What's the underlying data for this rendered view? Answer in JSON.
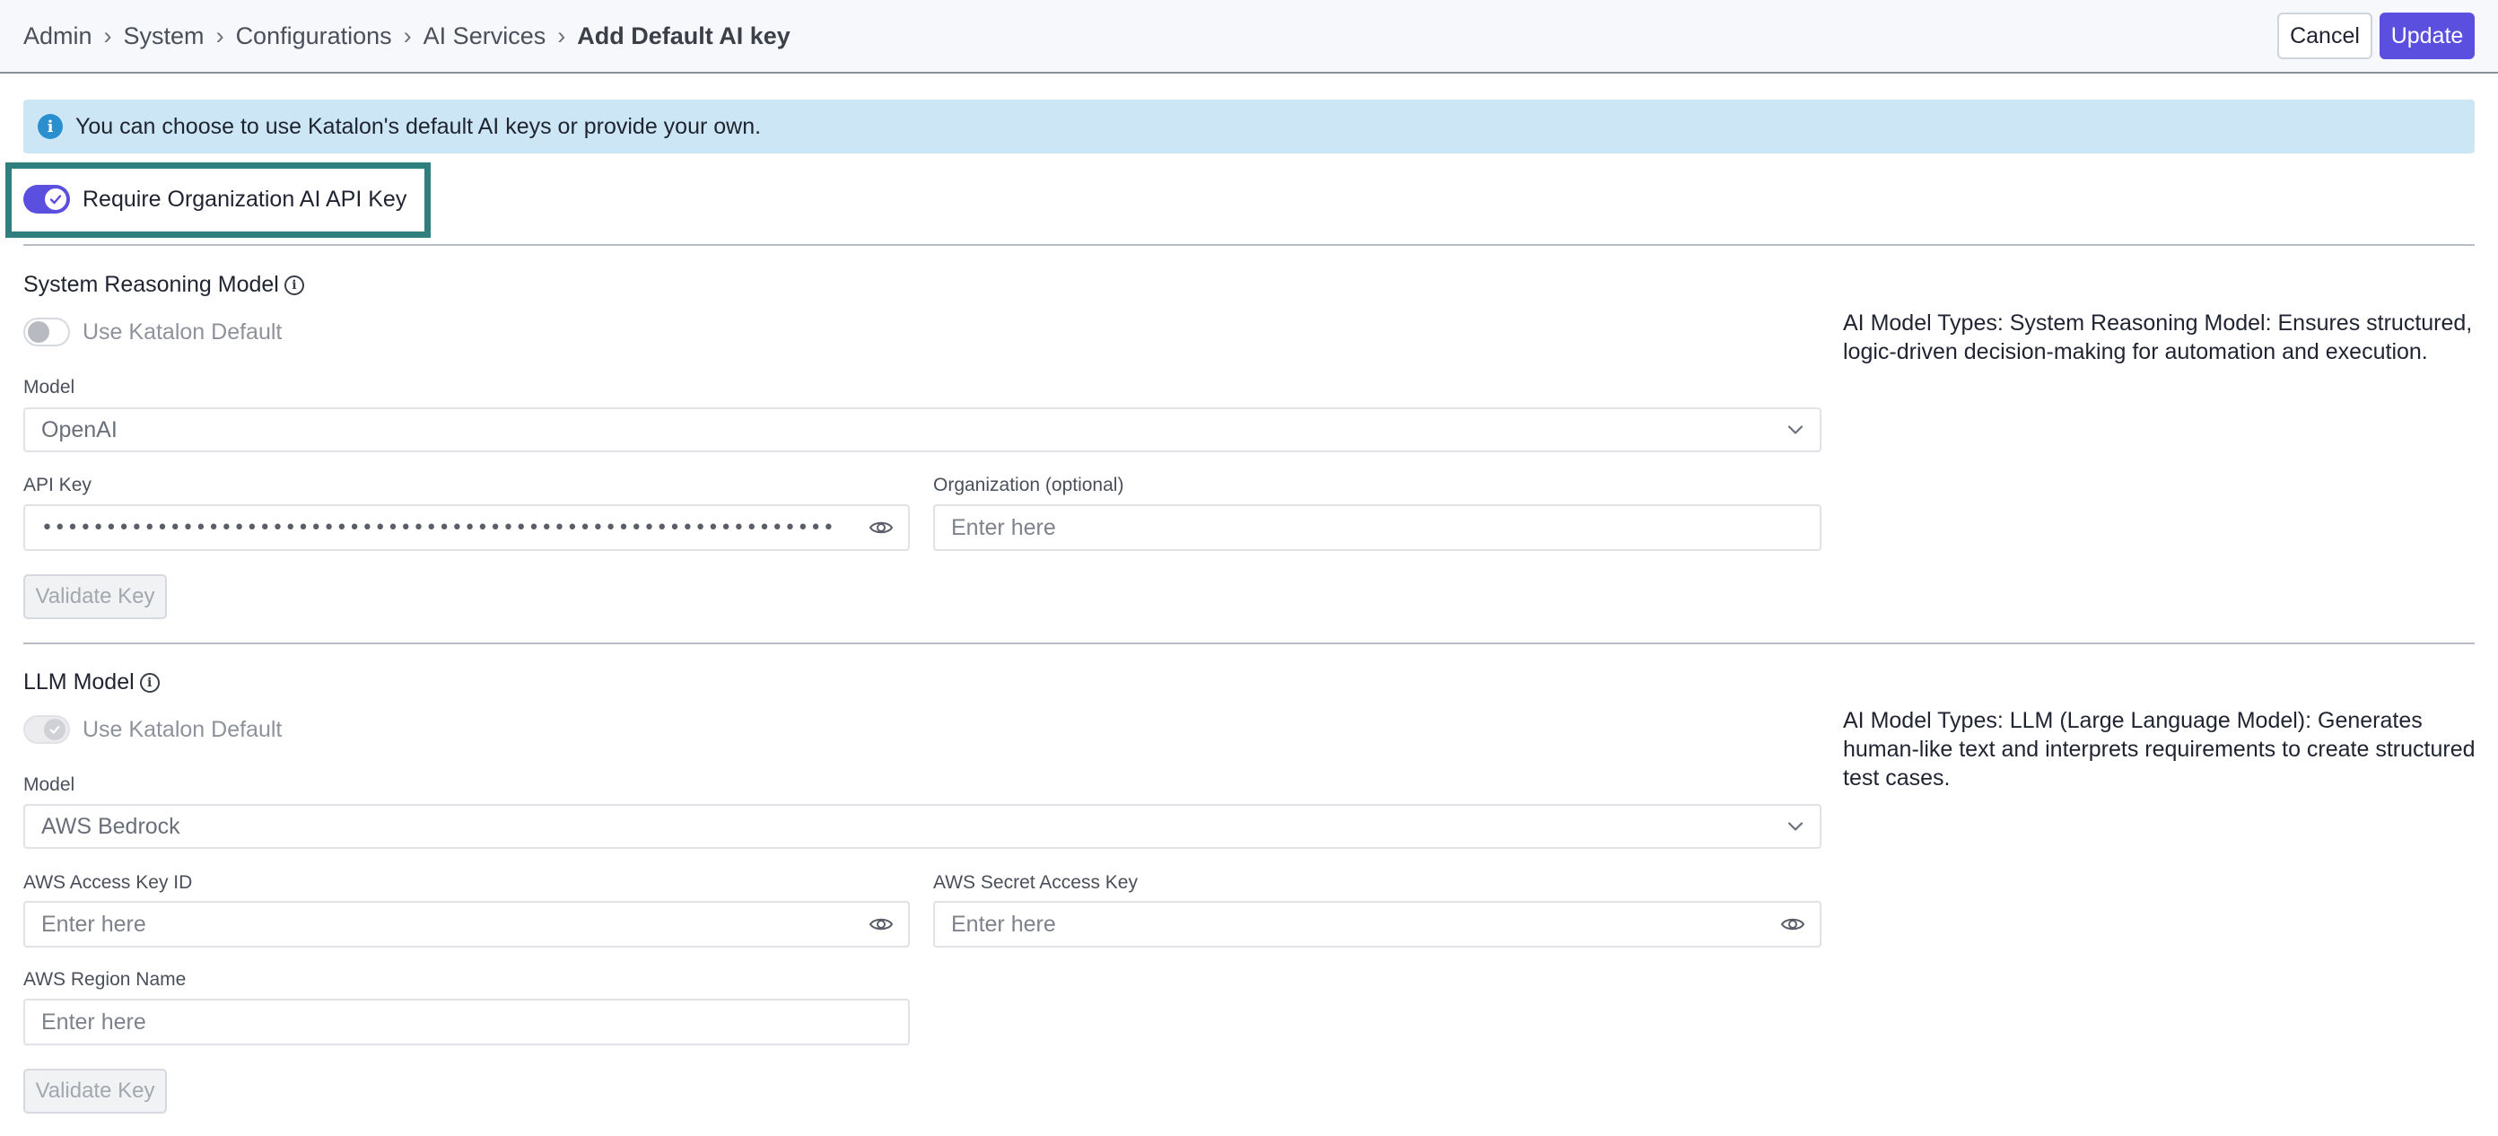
{
  "header": {
    "breadcrumbs": [
      "Admin",
      "System",
      "Configurations",
      "AI Services"
    ],
    "current": "Add Default AI key",
    "separator": "›",
    "cancel_label": "Cancel",
    "update_label": "Update"
  },
  "banner": {
    "text": "You can choose to use Katalon's default AI keys or provide your own."
  },
  "require_key": {
    "label": "Require Organization AI API Key",
    "enabled": true
  },
  "system_reasoning": {
    "title": "System Reasoning Model",
    "use_default_label": "Use Katalon Default",
    "use_default_enabled": false,
    "model_label": "Model",
    "model_value": "OpenAI",
    "api_key_label": "API Key",
    "api_key_value": "••••••••••••••••••••••••••••••••••••••••••••••••••••••••••••••",
    "org_label": "Organization (optional)",
    "org_placeholder": "Enter here",
    "validate_label": "Validate Key",
    "description": "AI Model Types: System Reasoning Model: Ensures structured, logic-driven decision-making for automation and execution."
  },
  "llm": {
    "title": "LLM Model",
    "use_default_label": "Use Katalon Default",
    "use_default_enabled": true,
    "model_label": "Model",
    "model_value": "AWS Bedrock",
    "access_key_label": "AWS Access Key ID",
    "access_key_placeholder": "Enter here",
    "secret_key_label": "AWS Secret Access Key",
    "secret_key_placeholder": "Enter here",
    "region_label": "AWS Region Name",
    "region_placeholder": "Enter here",
    "validate_label": "Validate Key",
    "description": "AI Model Types: LLM (Large Language Model): Generates human-like text and interprets requirements to create structured test cases."
  },
  "colors": {
    "accent": "#5b4fe0",
    "banner_bg": "#cce6f6",
    "highlight_border": "#2f7f7f"
  },
  "icons": [
    "info-icon",
    "check-icon",
    "chevron-down-icon",
    "eye-icon"
  ]
}
